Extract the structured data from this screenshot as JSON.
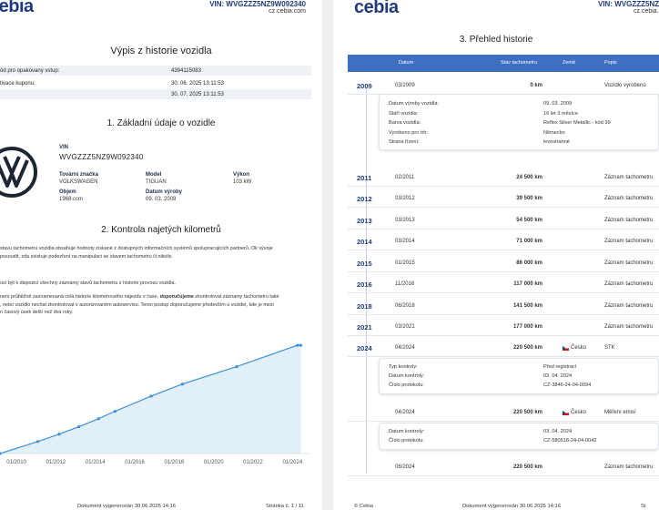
{
  "header": {
    "vin_line": "VIN: WVGZZZ5NZ9W092340",
    "website": "cz.cebia.com",
    "logo": "cebia"
  },
  "left_page": {
    "title": "Výpis z historie vozidla",
    "info_rows": [
      {
        "label": "ód pro opakovaný vstup:",
        "value": "4394115083"
      },
      {
        "label": "tivace kuponu:",
        "value": "30. 06. 2025 13:11:53"
      },
      {
        "label": "",
        "value": "30. 07. 2025 13:11:53"
      }
    ],
    "section1_title": "1. Základní údaje o vozidle",
    "vin_label": "VIN",
    "vin_value": "WVGZZZ5NZ9W092340",
    "fields": [
      {
        "label": "Tovární značka",
        "value": "VOLKSWAGEN"
      },
      {
        "label": "Model",
        "value": "TIGUAN"
      },
      {
        "label": "Výkon",
        "value": "103 kW"
      },
      {
        "label": "Objem",
        "value": "1968 ccm"
      },
      {
        "label": "Datum výroby",
        "value": "09. 03. 2009"
      }
    ],
    "section2_title": "2. Kontrola najetých kilometrů",
    "para1": "stavu tachometru vozidla obsahuje hodnoty získané z dostupných informačních systémů spolupracujících partnerů. Ok vývoje",
    "para1b": "posoudit, zda existuje podezření na manipulaci se stavem tachometru či nikoliv.",
    "para2": "usí být k dispozici všechny záznamy stavů tachometru z historie provozu vozidla.",
    "para3a": "není průběžně zaznamenaná celá historie kilometrového nájezdu v čase, ",
    "para3bold": "doporučujeme",
    "para3b": " zkontrolovat záznamy tachometru také",
    "para3c": ", nebo vozidlo nechat zkontrolovat v autorizovaném autoservisu. Tento postup doporučujeme především u vozidel, kde je mezi",
    "para3d": "n časový úsek delší než dva roky.",
    "footer_doc": "Dokument vygenerován 30.06.2025 14:16",
    "footer_page": "Stránka č. 1 / 11"
  },
  "chart_data": {
    "type": "line",
    "x_ticks": [
      "01/2010",
      "01/2012",
      "01/2014",
      "01/2016",
      "01/2018",
      "01/2020",
      "01/2022",
      "01/2024"
    ],
    "points": [
      {
        "date": "2009-03",
        "km": 0
      },
      {
        "date": "2011-02",
        "km": 24500
      },
      {
        "date": "2012-03",
        "km": 39500
      },
      {
        "date": "2013-03",
        "km": 54500
      },
      {
        "date": "2014-03",
        "km": 71000
      },
      {
        "date": "2015-01",
        "km": 86000
      },
      {
        "date": "2016-11",
        "km": 117000
      },
      {
        "date": "2018-06",
        "km": 141500
      },
      {
        "date": "2021-03",
        "km": 177000
      },
      {
        "date": "2024-04",
        "km": 220500
      },
      {
        "date": "2024-06",
        "km": 220500
      }
    ],
    "xlim": [
      "2009-03",
      "2024-08"
    ],
    "ylim": [
      0,
      230000
    ],
    "grid": false,
    "colors": {
      "line": "#3e8fd8",
      "fill": "#d9ebf8"
    }
  },
  "right_page": {
    "title": "3. Přehled historie",
    "columns": [
      "Datum",
      "Stav tachometru",
      "Země",
      "Popis"
    ],
    "rows": [
      {
        "year": "2009",
        "date": "03/2009",
        "km": "0 km",
        "country": "",
        "desc": "Vozidlo vyrobeno"
      },
      {
        "year": "2011",
        "date": "02/2011",
        "km": "24 500 km",
        "country": "",
        "desc": "Záznam tachometru"
      },
      {
        "year": "2012",
        "date": "03/2012",
        "km": "39 500 km",
        "country": "",
        "desc": "Záznam tachometru"
      },
      {
        "year": "2013",
        "date": "03/2013",
        "km": "54 500 km",
        "country": "",
        "desc": "Záznam tachometru"
      },
      {
        "year": "2014",
        "date": "03/2014",
        "km": "71 000 km",
        "country": "",
        "desc": "Záznam tachometru"
      },
      {
        "year": "2015",
        "date": "01/2015",
        "km": "86 000 km",
        "country": "",
        "desc": "Záznam tachometru"
      },
      {
        "year": "2016",
        "date": "11/2016",
        "km": "117 000 km",
        "country": "",
        "desc": "Záznam tachometru"
      },
      {
        "year": "2018",
        "date": "06/2018",
        "km": "141 500 km",
        "country": "",
        "desc": "Záznam tachometru"
      },
      {
        "year": "2021",
        "date": "03/2021",
        "km": "177 000 km",
        "country": "",
        "desc": "Záznam tachometru"
      },
      {
        "year": "2024",
        "date": "04/2024",
        "km": "220 500 km",
        "country": "Česko",
        "desc": "STK"
      },
      {
        "year": "",
        "date": "04/2024",
        "km": "220 500 km",
        "country": "Česko",
        "desc": "Měření emisí"
      },
      {
        "year": "",
        "date": "06/2024",
        "km": "220 500 km",
        "country": "",
        "desc": "Záznam tachometru"
      }
    ],
    "card_build": [
      {
        "k": "Datum výroby vozidla:",
        "v": "09. 03. 2009"
      },
      {
        "k": "Stáří vozidla:",
        "v": "16 let 3 měsíce"
      },
      {
        "k": "Barva vozidla:",
        "v": "Reflex Silver Metallic - kód 99"
      },
      {
        "k": "Vyrobeno pro trh:",
        "v": "Německo"
      },
      {
        "k": "Strana řízení:",
        "v": "levostranné"
      }
    ],
    "card_stk": [
      {
        "k": "Typ kontroly:",
        "v": "Před registrací"
      },
      {
        "k": "Datum kontroly:",
        "v": "03. 04. 2024"
      },
      {
        "k": "Číslo protokolu:",
        "v": "CZ-3846-24-04-0094"
      }
    ],
    "card_emise": [
      {
        "k": "Datum kontroly:",
        "v": "03. 04. 2024"
      },
      {
        "k": "Číslo protokolu:",
        "v": "CZ-580518-24-04-0042"
      }
    ],
    "footer_left": "© Cebia",
    "footer_doc": "Dokument vygenerován 30.06.2025 14:16",
    "footer_page": "St"
  }
}
